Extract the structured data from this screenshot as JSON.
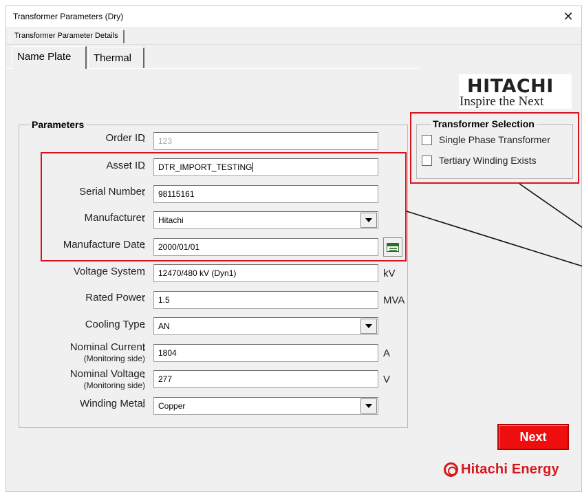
{
  "window": {
    "title": "Transformer Parameters (Dry)"
  },
  "outer_tab": {
    "label": "Transformer Parameter Details"
  },
  "tabs": [
    {
      "label": "Name Plate",
      "active": true
    },
    {
      "label": "Thermal",
      "active": false
    }
  ],
  "logo": {
    "name": "HITACHI",
    "tagline": "Inspire the Next"
  },
  "parameters": {
    "title": "Parameters",
    "order_id": {
      "label": "Order ID",
      "value": "123"
    },
    "asset_id": {
      "label": "Asset ID",
      "value": "DTR_IMPORT_TESTING"
    },
    "serial_number": {
      "label": "Serial Number",
      "value": "98115161"
    },
    "manufacturer": {
      "label": "Manufacturer",
      "value": "Hitachi"
    },
    "manufacture_date": {
      "label": "Manufacture Date",
      "value": "2000/01/01"
    },
    "voltage_system": {
      "label": "Voltage System",
      "value": "12470/480 kV (Dyn1)",
      "unit": "kV"
    },
    "rated_power": {
      "label": "Rated Power",
      "value": "1.5",
      "unit": "MVA"
    },
    "cooling_type": {
      "label": "Cooling Type",
      "value": "AN"
    },
    "nominal_current": {
      "label": "Nominal Current",
      "sublabel": "(Monitoring side)",
      "value": "1804",
      "unit": "A"
    },
    "nominal_voltage": {
      "label": "Nominal Voltage",
      "sublabel": "(Monitoring side)",
      "value": "277",
      "unit": "V"
    },
    "winding_metal": {
      "label": "Winding Metal",
      "value": "Copper"
    },
    "colon": ":"
  },
  "selection": {
    "title": "Transformer Selection",
    "single_phase": {
      "label": "Single Phase Transformer",
      "checked": false
    },
    "tertiary": {
      "label": "Tertiary Winding Exists",
      "checked": false
    }
  },
  "next_button": {
    "label": "Next"
  },
  "brand": {
    "text": "Hitachi Energy"
  },
  "colors": {
    "accent_red": "#ee0e0e",
    "highlight_red": "#d4161c",
    "dialog_bg": "#f0f0f0"
  },
  "icons": {
    "close": "close-icon",
    "calendar": "calendar-icon",
    "dropdown": "chevron-down-icon",
    "brand": "hitachi-energy-logo-icon"
  }
}
